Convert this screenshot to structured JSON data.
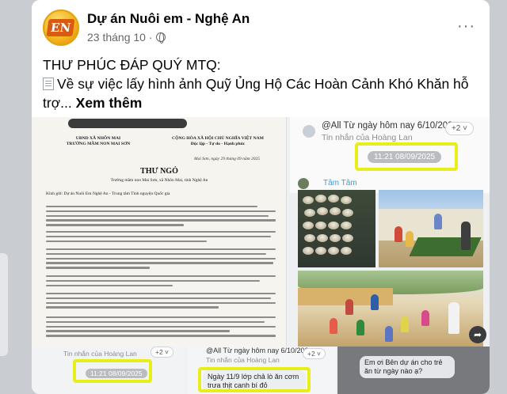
{
  "post": {
    "page_name": "Dự án Nuôi em - Nghệ An",
    "time": "23 tháng 10 ·",
    "avatar_text": "EN",
    "more_label": "···",
    "text_line1": "THƯ PHÚC ĐÁP QUÝ MTQ:",
    "text_line2": "Về sự việc lấy hình ảnh Quỹ Ủng Hộ Các Hoàn Cảnh Khó Khăn hỗ",
    "text_line3": "trợ...",
    "see_more": "Xem thêm"
  },
  "letter": {
    "org_left": "UBND XÃ NHÔN MAI\nTRƯỜNG MẦM NON MAI SƠN",
    "org_right": "CỘNG HÒA XÃ HỘI CHỦ NGHĨA VIỆT NAM\nĐộc lập - Tự do - Hạnh phúc",
    "date": "Mai Sơn, ngày 29 tháng 09 năm 2025",
    "title": "THƯ NGỎ",
    "subtitle": "Trường mầm non Mai Sơn, xã Nhôn Mai, tỉnh Nghệ An",
    "recipient": "Kính gửi: Dự án Nuôi Em Nghệ An - Trung tâm Tình nguyện Quốc gia"
  },
  "chat_top": {
    "title": "@All Từ ngày hôm nay 6/10/202...",
    "sub": "Tin nhắn của Hoàng Lan",
    "badge": "+2 ˅",
    "timestamp": "11:21 08/09/2025",
    "sender": "Tâm Tâm"
  },
  "strip": {
    "s1_sub": "Tin nhắn của Hoàng Lan",
    "s1_time": "11:21 08/09/2025",
    "s2_title": "@All Từ ngày hôm nay 6/10/202...",
    "s2_sub": "Tin nhắn của Hoàng Lan",
    "s2_badge": "+2 ˅",
    "s2_bubble": "Ngày 11/9 lớp chả lò ăn cơm trưa thịt canh bí đỏ",
    "s3_bubble": "Em ơi Bên dự án cho trẻ ăn từ ngày nào ạ?",
    "s1_badge": "+2 ˅"
  },
  "colors": {
    "highlight": "#e8ee1a",
    "link_blue": "#3aa0d8",
    "meta_gray": "#65676b"
  }
}
